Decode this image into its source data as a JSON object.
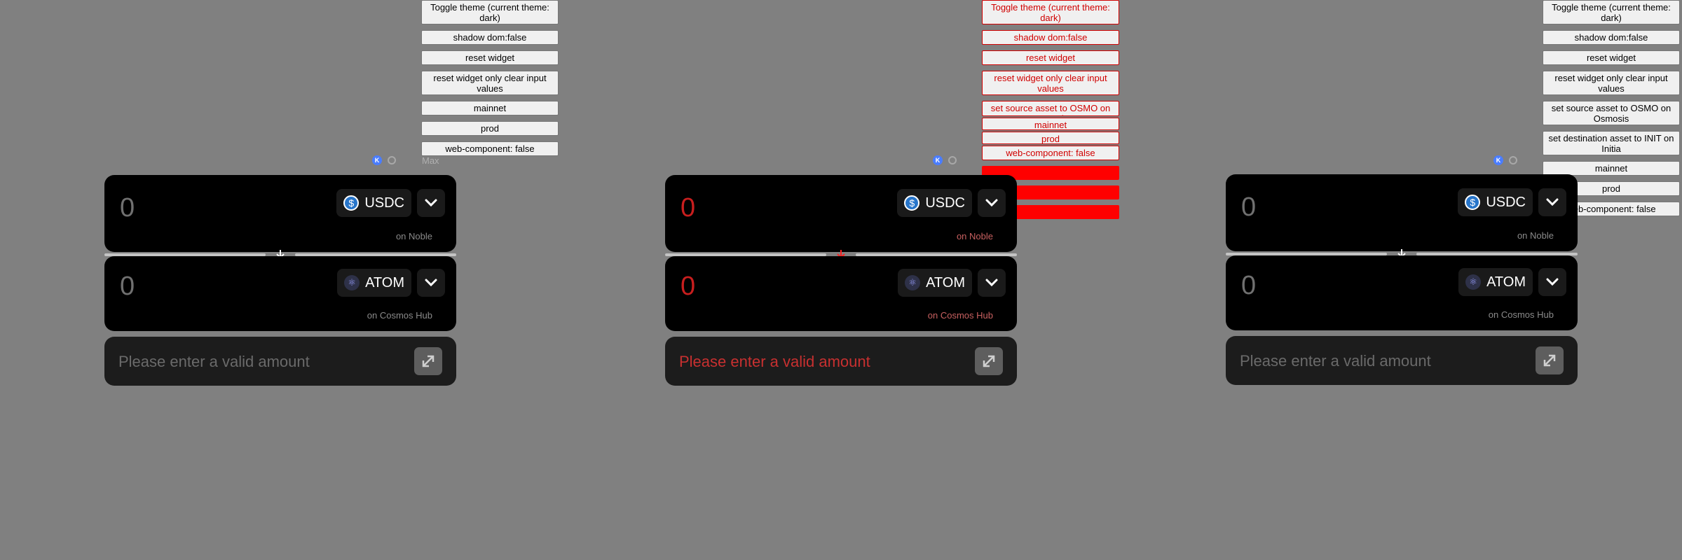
{
  "controls": {
    "toggle_theme": "Toggle theme (current theme: dark)",
    "shadow_dom": "shadow dom:false",
    "reset_widget": "reset widget",
    "reset_clear": "reset widget only clear input values",
    "mainnet": "mainnet",
    "prod": "prod",
    "web_component": "web-component: false",
    "set_source": "set source asset to OSMO on Osmosis",
    "set_destination": "set destination asset to INIT on Initia",
    "max_label": "Max",
    "status_icon_letter": "K"
  },
  "widget": {
    "source": {
      "amount": "0",
      "asset": "USDC",
      "asset_icon": "usdc-icon",
      "chain": "on Noble"
    },
    "destination": {
      "amount": "0",
      "asset": "ATOM",
      "asset_icon": "atom-icon",
      "chain": "on Cosmos Hub"
    },
    "submit_label": "Please enter a valid amount"
  },
  "colors": {
    "background": "#808080",
    "card": "#000000",
    "debug_red": "#ff0000",
    "usdc_blue": "#2775ca"
  }
}
